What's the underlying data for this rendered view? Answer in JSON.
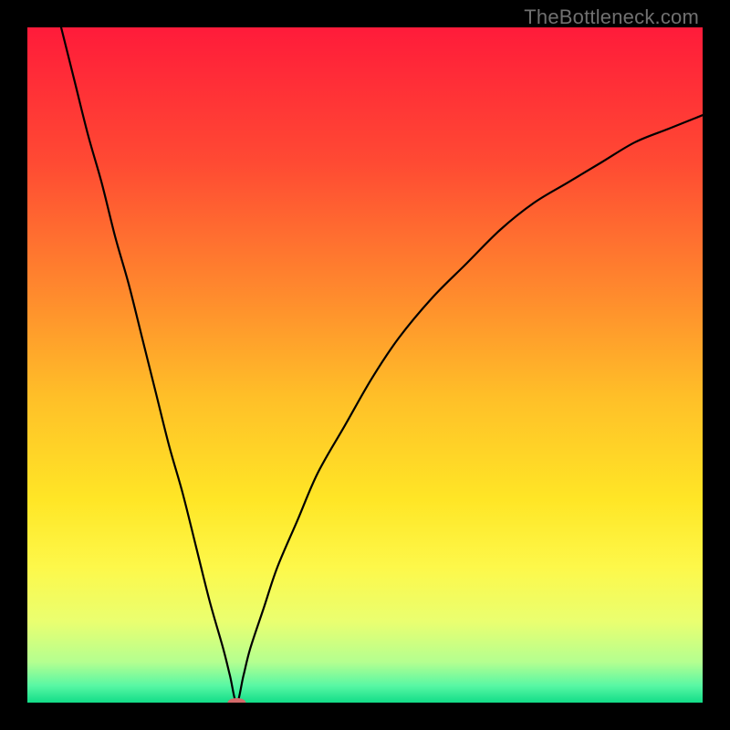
{
  "watermark": "TheBottleneck.com",
  "chart_data": {
    "type": "line",
    "title": "",
    "xlabel": "",
    "ylabel": "",
    "xlim": [
      0,
      100
    ],
    "ylim": [
      0,
      100
    ],
    "grid": false,
    "legend": false,
    "background_gradient": {
      "type": "vertical",
      "stops": [
        {
          "pos": 0.0,
          "color": "#ff1b3a"
        },
        {
          "pos": 0.2,
          "color": "#ff4a33"
        },
        {
          "pos": 0.4,
          "color": "#ff8c2d"
        },
        {
          "pos": 0.55,
          "color": "#ffc028"
        },
        {
          "pos": 0.7,
          "color": "#ffe626"
        },
        {
          "pos": 0.8,
          "color": "#fdf84a"
        },
        {
          "pos": 0.88,
          "color": "#eaff70"
        },
        {
          "pos": 0.94,
          "color": "#b4ff90"
        },
        {
          "pos": 0.975,
          "color": "#58f7a4"
        },
        {
          "pos": 1.0,
          "color": "#12dd88"
        }
      ]
    },
    "marker": {
      "x": 31,
      "y": 0,
      "color": "#d36a6a",
      "rx": 10,
      "ry": 5
    },
    "series": [
      {
        "name": "curve",
        "color": "#000000",
        "x": [
          5,
          7,
          9,
          11,
          13,
          15,
          17,
          19,
          21,
          23,
          25,
          27,
          29,
          30,
          31,
          32,
          33,
          35,
          37,
          40,
          43,
          47,
          51,
          55,
          60,
          65,
          70,
          75,
          80,
          85,
          90,
          95,
          100
        ],
        "y": [
          100,
          92,
          84,
          77,
          69,
          62,
          54,
          46,
          38,
          31,
          23,
          15,
          8,
          4,
          0,
          4,
          8,
          14,
          20,
          27,
          34,
          41,
          48,
          54,
          60,
          65,
          70,
          74,
          77,
          80,
          83,
          85,
          87
        ]
      }
    ]
  }
}
